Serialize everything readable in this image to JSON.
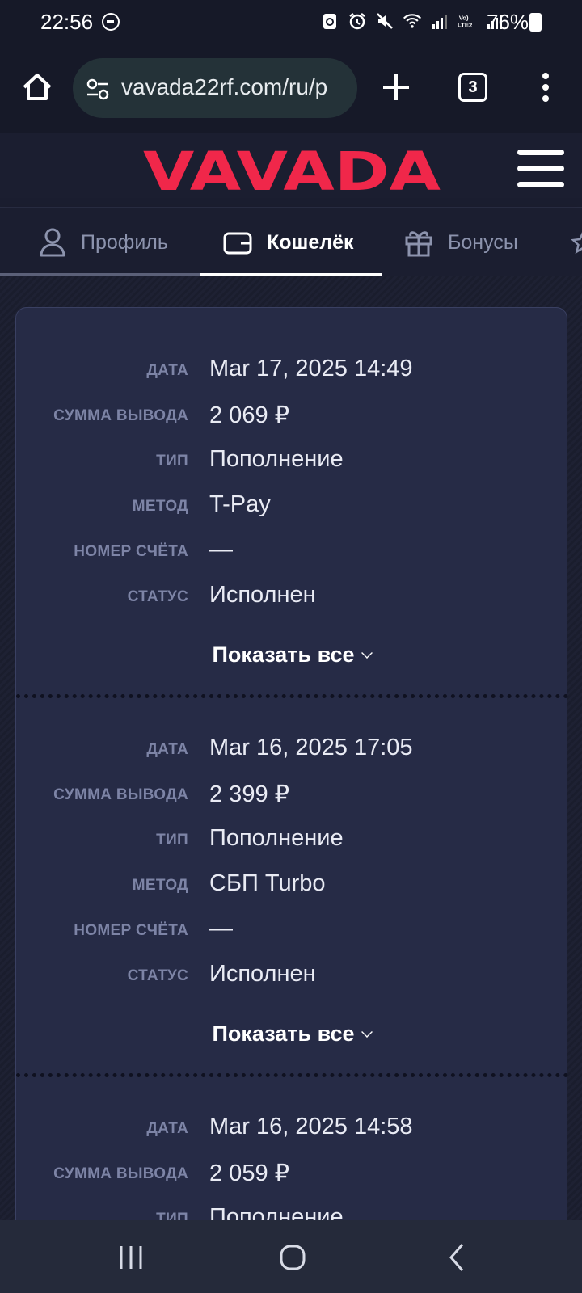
{
  "status_bar": {
    "time": "22:56",
    "battery": "76%",
    "icons": [
      "dnd-icon",
      "sync-icon",
      "alarm-icon",
      "mute-icon",
      "wifi-icon",
      "signal-icon",
      "volte-lte2-icon",
      "signal2-icon",
      "battery-icon"
    ]
  },
  "browser": {
    "url": "vavada22rf.com/ru/p",
    "tab_count": "3"
  },
  "site": {
    "logo": "VAVADA",
    "accent": "#f0274a"
  },
  "tabs": [
    {
      "label": "Профиль",
      "icon": "user-icon",
      "active": false
    },
    {
      "label": "Кошелёк",
      "icon": "wallet-icon",
      "active": true
    },
    {
      "label": "Бонусы",
      "icon": "gift-icon",
      "active": false
    }
  ],
  "labels": {
    "date": "ДАТА",
    "amount": "СУММА ВЫВОДА",
    "type": "ТИП",
    "method": "МЕТОД",
    "account": "НОМЕР СЧЁТА",
    "status": "СТАТУС",
    "show_all": "Показать все"
  },
  "transactions": [
    {
      "date": "Mar 17, 2025 14:49",
      "amount": "2 069 ₽",
      "type": "Пополнение",
      "method": "T-Pay",
      "account": "—",
      "status": "Исполнен"
    },
    {
      "date": "Mar 16, 2025 17:05",
      "amount": "2 399 ₽",
      "type": "Пополнение",
      "method": "СБП Turbo",
      "account": "—",
      "status": "Исполнен"
    },
    {
      "date": "Mar 16, 2025 14:58",
      "amount": "2 059 ₽",
      "type": "Пополнение"
    }
  ]
}
